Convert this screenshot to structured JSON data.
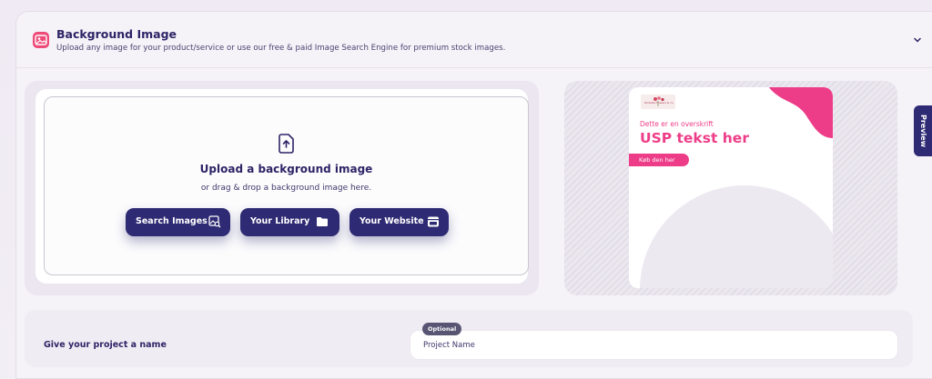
{
  "section": {
    "title": "Background Image",
    "subtitle": "Upload any image for your product/service or use our free & paid Image Search Engine for premium stock images."
  },
  "upload": {
    "title": "Upload a background image",
    "subtitle": "or drag & drop a background image here.",
    "buttons": {
      "search": "Search Images",
      "library": "Your Library",
      "website": "Your Website"
    }
  },
  "preview": {
    "tab_label": "Preview",
    "ad": {
      "logo_text": "Ondalla Flowers & co",
      "heading": "Dette er en overskrift",
      "usp": "USP tekst her",
      "cta": "Køb den her"
    },
    "colors": {
      "accent": "#ee3d88",
      "primary": "#2e2a73"
    }
  },
  "project": {
    "label": "Give your project a name",
    "badge": "Optional",
    "placeholder": "Project Name"
  }
}
